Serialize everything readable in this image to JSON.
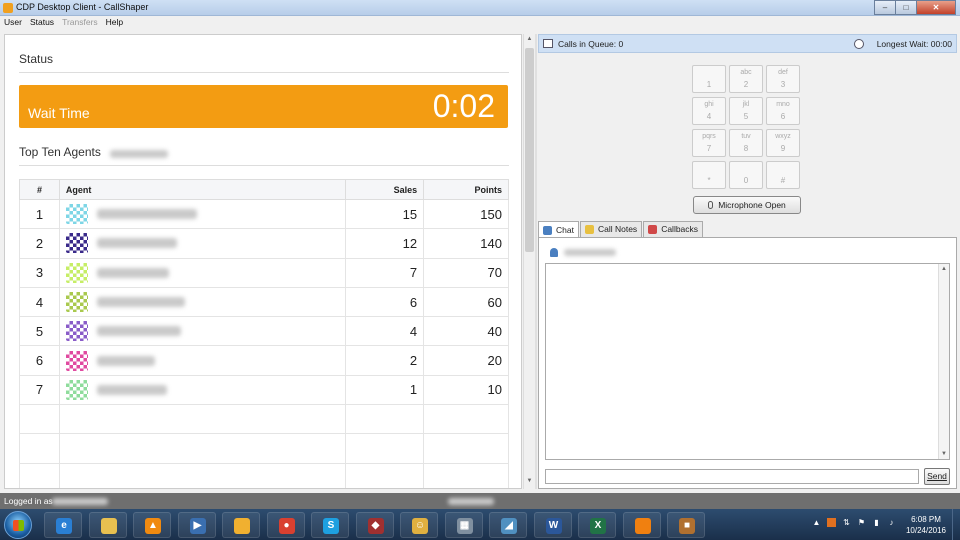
{
  "window": {
    "title": "CDP Desktop Client - CallShaper",
    "minimize": "–",
    "maximize": "□",
    "close": "✕"
  },
  "menu": {
    "items": [
      "User",
      "Status",
      "Transfers",
      "Help"
    ]
  },
  "status_panel": {
    "title": "Status",
    "wait_label": "Wait Time",
    "wait_value": "0:02",
    "wait_color": "#f39c12",
    "top_ten_title": "Top Ten Agents",
    "columns": {
      "rank": "#",
      "agent": "Agent",
      "sales": "Sales",
      "points": "Points"
    },
    "agents": [
      {
        "rank": "1",
        "sales": "15",
        "points": "150",
        "avatar_color": "#7ed6e6"
      },
      {
        "rank": "2",
        "sales": "12",
        "points": "140",
        "avatar_color": "#3a2a8a"
      },
      {
        "rank": "3",
        "sales": "7",
        "points": "70",
        "avatar_color": "#c6ee66"
      },
      {
        "rank": "4",
        "sales": "6",
        "points": "60",
        "avatar_color": "#a9c94e"
      },
      {
        "rank": "5",
        "sales": "4",
        "points": "40",
        "avatar_color": "#8a5cc8"
      },
      {
        "rank": "6",
        "sales": "2",
        "points": "20",
        "avatar_color": "#e04aa0"
      },
      {
        "rank": "7",
        "sales": "1",
        "points": "10",
        "avatar_color": "#8fdc9c"
      }
    ]
  },
  "queue": {
    "calls_label": "Calls in Queue: 0",
    "wait_label": "Longest Wait: 00:00"
  },
  "dialpad": {
    "keys": [
      {
        "letters": "",
        "digit": "1"
      },
      {
        "letters": "abc",
        "digit": "2"
      },
      {
        "letters": "def",
        "digit": "3"
      },
      {
        "letters": "ghi",
        "digit": "4"
      },
      {
        "letters": "jkl",
        "digit": "5"
      },
      {
        "letters": "mno",
        "digit": "6"
      },
      {
        "letters": "pqrs",
        "digit": "7"
      },
      {
        "letters": "tuv",
        "digit": "8"
      },
      {
        "letters": "wxyz",
        "digit": "9"
      },
      {
        "letters": "",
        "digit": "*"
      },
      {
        "letters": "",
        "digit": "0"
      },
      {
        "letters": "",
        "digit": "#"
      }
    ],
    "mic_label": "Microphone Open"
  },
  "tabs": [
    {
      "label": "Chat",
      "icon": "person-icon",
      "color": "#4a7fc0"
    },
    {
      "label": "Call Notes",
      "icon": "notes-icon",
      "color": "#e8c040"
    },
    {
      "label": "Callbacks",
      "icon": "calendar-icon",
      "color": "#d04848"
    }
  ],
  "chat": {
    "send_label": "Send",
    "input_value": ""
  },
  "statusbar": {
    "logged_in": "Logged in as"
  },
  "taskbar": {
    "apps": [
      {
        "name": "internet-explorer-icon",
        "color": "#2a7fd4",
        "glyph": "e"
      },
      {
        "name": "file-explorer-icon",
        "color": "#e8c050",
        "glyph": ""
      },
      {
        "name": "vlc-icon",
        "color": "#f08a10",
        "glyph": "▲"
      },
      {
        "name": "media-player-icon",
        "color": "#3a6fb0",
        "glyph": "▶"
      },
      {
        "name": "folder-icon",
        "color": "#f0b030",
        "glyph": ""
      },
      {
        "name": "chrome-icon",
        "color": "#d94030",
        "glyph": "●"
      },
      {
        "name": "skype-icon",
        "color": "#1ea0e0",
        "glyph": "S"
      },
      {
        "name": "game-icon",
        "color": "#a03030",
        "glyph": "◆"
      },
      {
        "name": "messenger-icon",
        "color": "#e0b040",
        "glyph": "☺"
      },
      {
        "name": "calculator-icon",
        "color": "#8090a0",
        "glyph": "▦"
      },
      {
        "name": "notes-app-icon",
        "color": "#5090c0",
        "glyph": "◢"
      },
      {
        "name": "word-icon",
        "color": "#2b579a",
        "glyph": "W"
      },
      {
        "name": "excel-icon",
        "color": "#217346",
        "glyph": "X"
      },
      {
        "name": "orange-app-icon",
        "color": "#f08010",
        "glyph": ""
      },
      {
        "name": "box-app-icon",
        "color": "#b07030",
        "glyph": "■"
      }
    ],
    "time": "6:08 PM",
    "date": "10/24/2016"
  }
}
